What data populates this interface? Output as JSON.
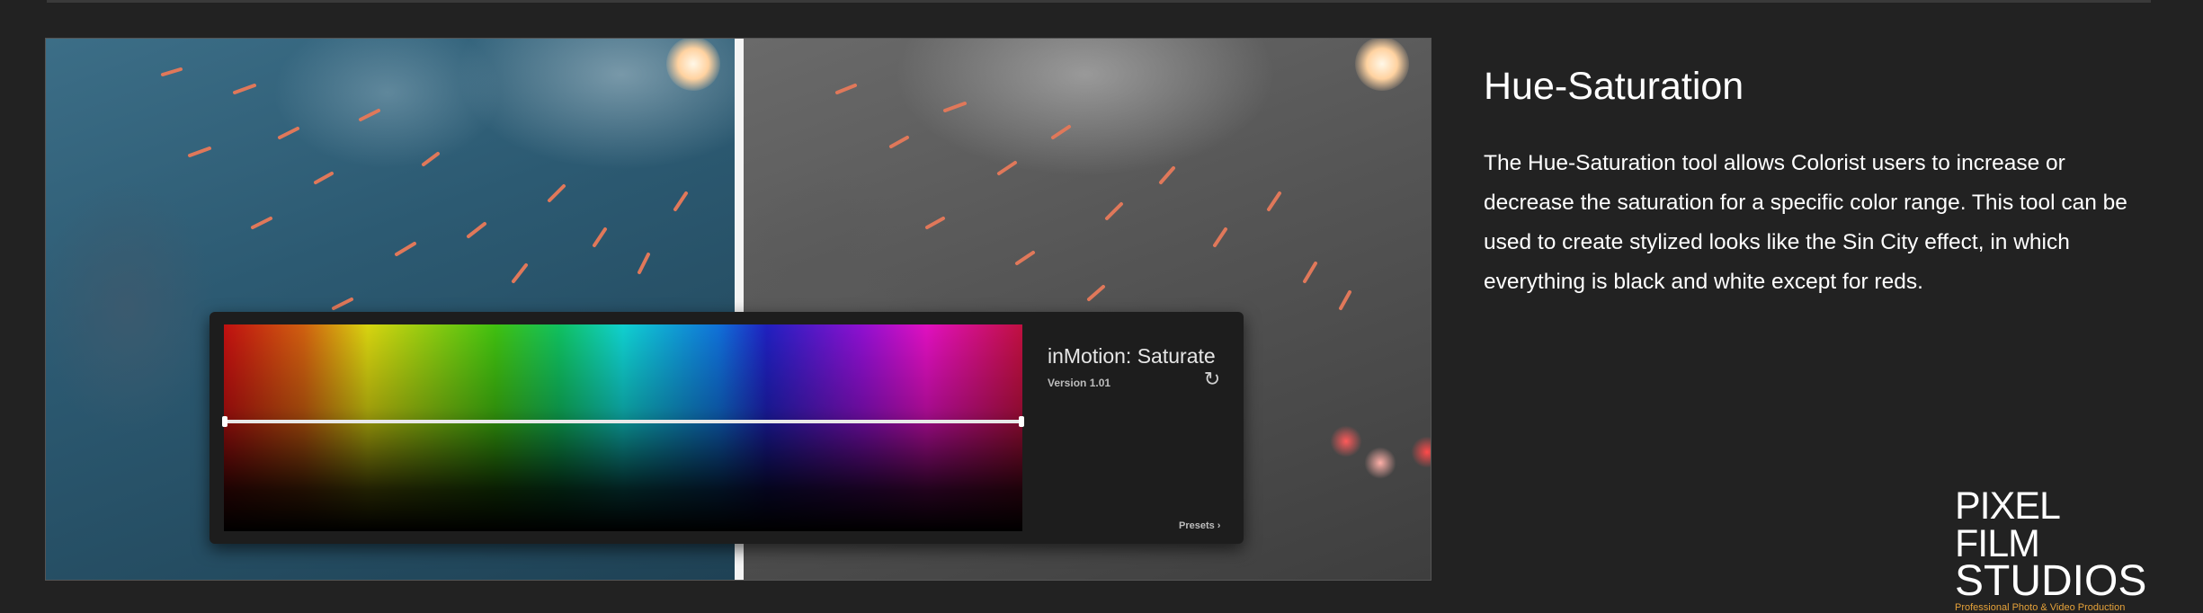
{
  "colors": {
    "background": "#222222",
    "tag": "#e6a23a",
    "text": "#ffffff"
  },
  "comparison": {
    "left_image": "color-original-photo",
    "right_image": "desaturated-reds-kept-photo"
  },
  "plugin_panel": {
    "title": "inMotion: Saturate",
    "version": "Version 1.01",
    "reset_icon": "refresh-icon",
    "presets_label": "Presets ›"
  },
  "article": {
    "heading": "Hue-Saturation",
    "body": "The Hue-Saturation tool allows Colorist users to increase or decrease the saturation for a specific color range. This tool can be used to create stylized looks like the Sin City effect, in which everything is black and white except for reds."
  },
  "logo": {
    "line1": "PIXEL FILM",
    "line2": "STUDIOS",
    "tagline": "Professional Photo & Video Production"
  }
}
